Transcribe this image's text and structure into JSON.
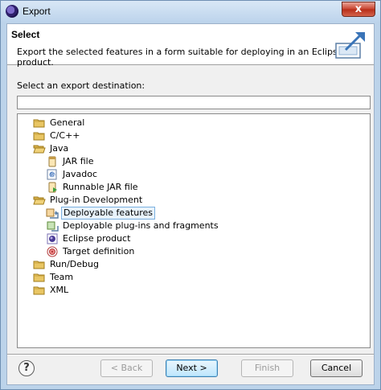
{
  "window": {
    "title": "Export",
    "close_glyph": "x"
  },
  "header": {
    "title": "Select",
    "description": "Export the selected features in a form suitable for deploying in an Eclipse product.",
    "icon": "export-wizard-icon"
  },
  "destination": {
    "label": "Select an export destination:",
    "filter_value": ""
  },
  "tree": {
    "nodes": [
      {
        "label": "General",
        "icon": "folder-icon",
        "level": 0
      },
      {
        "label": "C/C++",
        "icon": "folder-icon",
        "level": 0
      },
      {
        "label": "Java",
        "icon": "folder-open-icon",
        "level": 0
      },
      {
        "label": "JAR file",
        "icon": "jar-icon",
        "level": 1
      },
      {
        "label": "Javadoc",
        "icon": "javadoc-icon",
        "level": 1
      },
      {
        "label": "Runnable JAR file",
        "icon": "runnable-jar-icon",
        "level": 1
      },
      {
        "label": "Plug-in Development",
        "icon": "folder-open-icon",
        "level": 0
      },
      {
        "label": "Deployable features",
        "icon": "feature-icon",
        "level": 1,
        "selected": true
      },
      {
        "label": "Deployable plug-ins and fragments",
        "icon": "plugin-icon",
        "level": 1
      },
      {
        "label": "Eclipse product",
        "icon": "product-icon",
        "level": 1
      },
      {
        "label": "Target definition",
        "icon": "target-icon",
        "level": 1
      },
      {
        "label": "Run/Debug",
        "icon": "folder-icon",
        "level": 0
      },
      {
        "label": "Team",
        "icon": "folder-icon",
        "level": 0
      },
      {
        "label": "XML",
        "icon": "folder-icon",
        "level": 0
      }
    ]
  },
  "buttons": {
    "help": "?",
    "back": "< Back",
    "next": "Next >",
    "finish": "Finish",
    "cancel": "Cancel"
  }
}
